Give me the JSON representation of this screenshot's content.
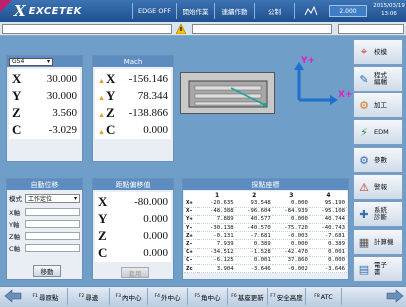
{
  "app": {
    "logo_mark": "X",
    "logo_text": "EXCETEK"
  },
  "header": {
    "tabs": [
      {
        "label": "EDGE OFF"
      },
      {
        "label": "開始作業"
      },
      {
        "label": "連續作動"
      },
      {
        "label": "公制"
      }
    ],
    "spindle_value": "2.000",
    "date": "2015/03/19",
    "time": "13:06"
  },
  "absolute_panel": {
    "dropdown": "G54",
    "rows": [
      {
        "axis": "X",
        "value": "30.000"
      },
      {
        "axis": "Y",
        "value": "30.000"
      },
      {
        "axis": "Z",
        "value": "3.560"
      },
      {
        "axis": "C",
        "value": "-3.029"
      }
    ]
  },
  "mach_panel": {
    "title": "Mach",
    "rows": [
      {
        "axis": "X",
        "value": "-156.146"
      },
      {
        "axis": "Y",
        "value": "78.344"
      },
      {
        "axis": "Z",
        "value": "-138.866"
      },
      {
        "axis": "C",
        "value": "0.000"
      }
    ]
  },
  "axis_indicator": {
    "y_label": "Y+",
    "x_label": "X+"
  },
  "auto_position_panel": {
    "title": "自動位移",
    "mode_label": "模式",
    "mode_value": "工作定位",
    "axes": [
      "X軸",
      "Y軸",
      "Z軸",
      "C軸"
    ],
    "move_button": "移動"
  },
  "offset_panel": {
    "title": "距點偏移值",
    "rows": [
      {
        "axis": "X",
        "value": "-80.000"
      },
      {
        "axis": "Y",
        "value": "0.000"
      },
      {
        "axis": "Z",
        "value": "0.000"
      },
      {
        "axis": "C",
        "value": "0.000"
      }
    ],
    "button": "套用"
  },
  "coordinate_panel": {
    "title": "探點座標",
    "columns": [
      "",
      "1",
      "2",
      "3",
      "4"
    ],
    "rows": [
      {
        "label": "X+",
        "values": [
          "-20.635",
          "93.548",
          "0.000",
          "95.190"
        ]
      },
      {
        "label": "X-",
        "values": [
          "-48.388",
          "-96.604",
          "-84.939",
          "-95.108"
        ]
      },
      {
        "label": "Y+",
        "values": [
          "7.889",
          "40.577",
          "0.000",
          "40.744"
        ]
      },
      {
        "label": "Y-",
        "values": [
          "-30.138",
          "-40.570",
          "-75.720",
          "-40.743"
        ]
      },
      {
        "label": "Z+",
        "values": [
          "-0.131",
          "-7.681",
          "-0.003",
          "-7.681"
        ]
      },
      {
        "label": "Z-",
        "values": [
          "7.939",
          "0.389",
          "0.000",
          "0.389"
        ]
      },
      {
        "label": "C+",
        "values": [
          "-34.512",
          "-1.528",
          "-42.470",
          "0.001"
        ]
      },
      {
        "label": "C-",
        "values": [
          "-6.125",
          "0.001",
          "37.860",
          "0.000"
        ]
      },
      {
        "label": "Zc",
        "values": [
          "3.904",
          "-3.646",
          "-0.002",
          "-3.646"
        ]
      }
    ]
  },
  "sidebar": {
    "items": [
      {
        "label": "校模"
      },
      {
        "label": "程式\n編輯"
      },
      {
        "label": "加工"
      },
      {
        "label": "EDM"
      },
      {
        "label": "參數"
      },
      {
        "label": "警報"
      },
      {
        "label": "系統\n診斷"
      },
      {
        "label": "計算機"
      },
      {
        "label": "電子\n書"
      }
    ]
  },
  "footer": {
    "keys": [
      {
        "num": "F1",
        "label": "尋原點"
      },
      {
        "num": "F2",
        "label": "尋邊"
      },
      {
        "num": "F3",
        "label": "內中心"
      },
      {
        "num": "F4",
        "label": "外中心"
      },
      {
        "num": "F5",
        "label": "角中心"
      },
      {
        "num": "F6",
        "label": "基座更新"
      },
      {
        "num": "F7",
        "label": "安全高度"
      },
      {
        "num": "F8",
        "label": "ATC"
      }
    ]
  },
  "colors": {
    "accent": "#5d8cc0",
    "axis_arrow": "#1f6fd0",
    "pink_arrow": "#e020c0",
    "brand_corner": "#c0206a"
  }
}
